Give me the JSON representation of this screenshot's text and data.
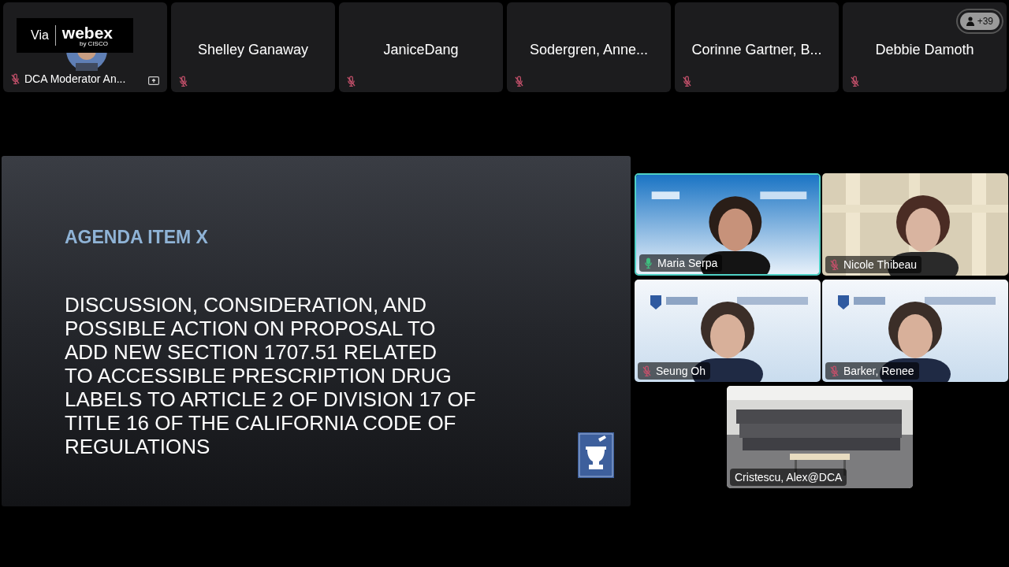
{
  "participant_strip": [
    {
      "name": "DCA Moderator An...",
      "muted": true,
      "sharing": true,
      "overlay": {
        "prefix": "Via",
        "brand": "webex",
        "byline": "by CISCO"
      },
      "has_video": true
    },
    {
      "name": "Shelley Ganaway",
      "muted": true,
      "sharing": false,
      "has_video": false
    },
    {
      "name": "JaniceDang",
      "muted": true,
      "sharing": false,
      "has_video": false
    },
    {
      "name": "Sodergren, Anne...",
      "muted": true,
      "sharing": false,
      "has_video": false
    },
    {
      "name": "Corinne Gartner, B...",
      "muted": true,
      "sharing": false,
      "has_video": false
    },
    {
      "name": "Debbie Damoth",
      "muted": true,
      "sharing": false,
      "has_video": false
    }
  ],
  "more_participants": "+39",
  "shared_slide": {
    "title": "AGENDA ITEM X",
    "body_lines": [
      "DISCUSSION, CONSIDERATION, AND",
      "POSSIBLE ACTION ON PROPOSAL TO",
      "ADD NEW SECTION 1707.51 RELATED",
      "TO ACCESSIBLE PRESCRIPTION DRUG",
      "LABELS TO ARTICLE 2 OF DIVISION 17 OF",
      "TITLE 16 OF THE CALIFORNIA CODE OF",
      "REGULATIONS"
    ]
  },
  "video_tiles": [
    {
      "name": "Maria Serpa",
      "muted": false,
      "active_speaker": true
    },
    {
      "name": "Nicole Thibeau",
      "muted": true,
      "active_speaker": false
    },
    {
      "name": "Seung Oh",
      "muted": true,
      "active_speaker": false
    },
    {
      "name": "Barker, Renee",
      "muted": true,
      "active_speaker": false
    },
    {
      "name": "Cristescu, Alex@DCA",
      "muted": false,
      "active_speaker": false
    }
  ]
}
